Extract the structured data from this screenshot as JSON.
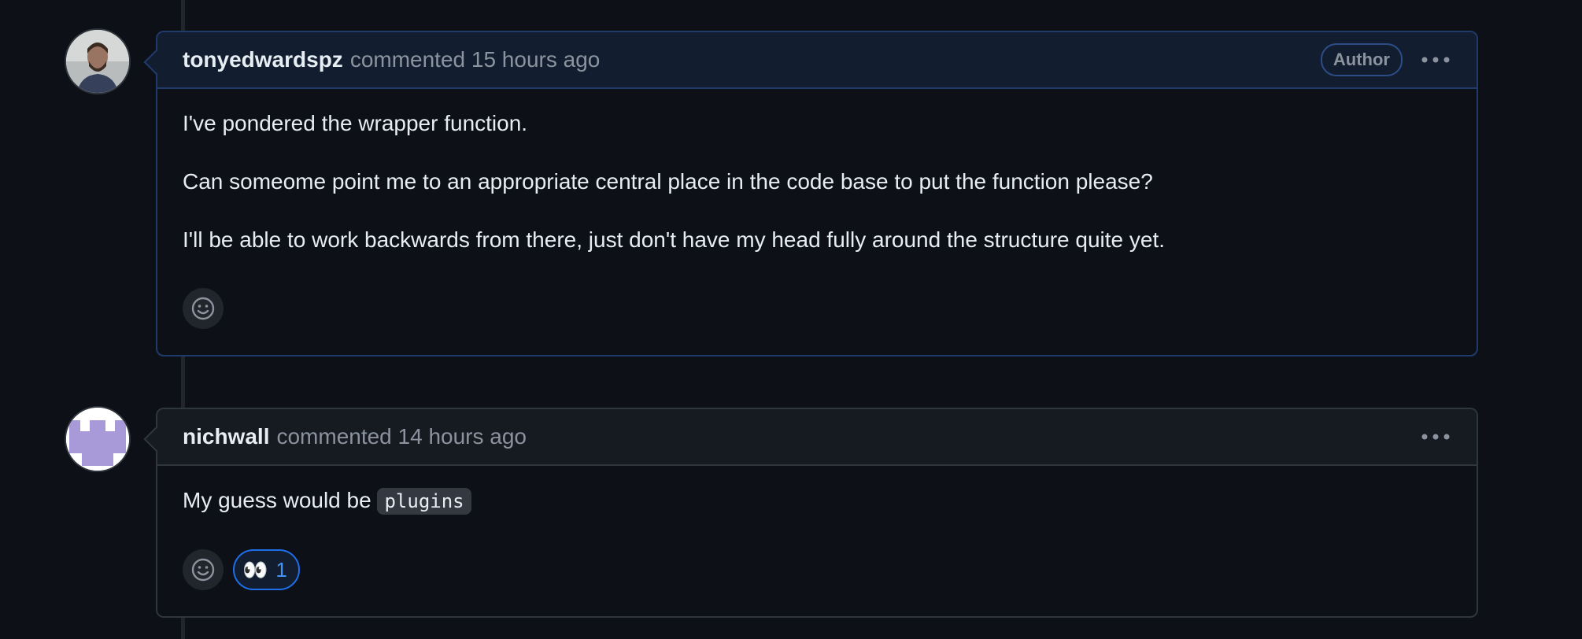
{
  "comments": [
    {
      "username": "tonyedwardspz",
      "meta": "commented 15 hours ago",
      "badge": "Author",
      "paragraphs": [
        "I've pondered the wrapper function.",
        "Can someome point me to an appropriate central place in the code base to put the function please?",
        "I'll be able to work backwards from there, just don't have my head fully around the structure quite yet."
      ]
    },
    {
      "username": "nichwall",
      "meta": "commented 14 hours ago",
      "body_text": "My guess would be ",
      "body_code": "plugins",
      "reaction": {
        "emoji": "👀",
        "count": "1"
      }
    }
  ],
  "icons": {
    "more": "kebab-horizontal-icon",
    "add_reaction": "smiley-icon"
  },
  "colors": {
    "background": "#0d1117",
    "author_border": "#1f3a6b",
    "accent": "#1f6feb"
  }
}
